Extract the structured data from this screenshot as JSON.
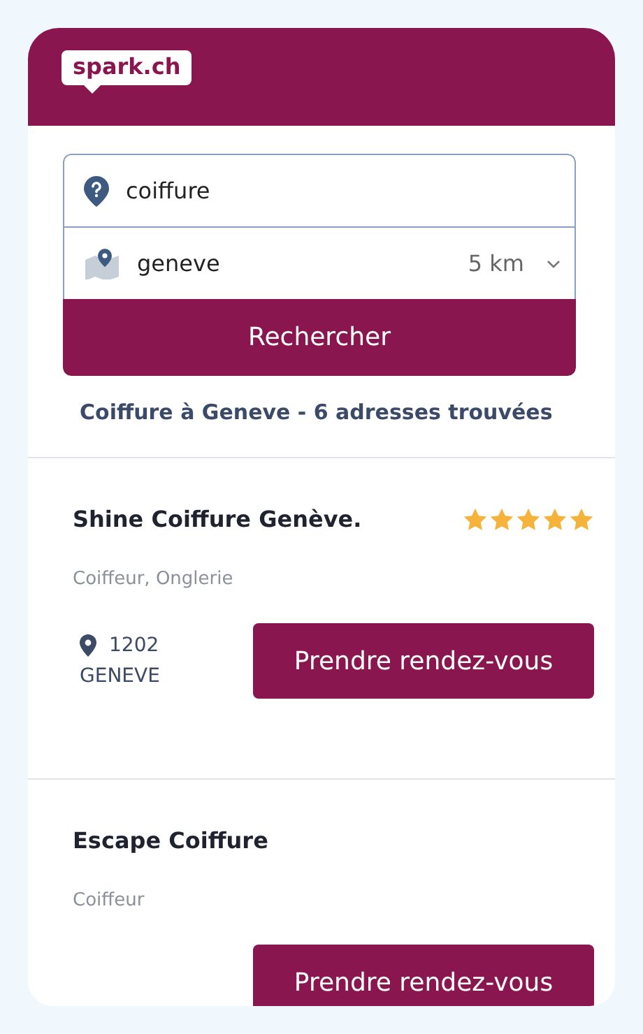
{
  "header": {
    "logo": "spark.ch"
  },
  "search": {
    "query": "coiffure",
    "location": "geneve",
    "radius": "5 km",
    "button": "Rechercher"
  },
  "results_title": "Coiffure à Geneve - 6 adresses trouvées",
  "results": [
    {
      "name": "Shine Coiffure Genève.",
      "stars": 5,
      "categories": "Coiffeur, Onglerie",
      "postcode": "1202",
      "city": "GENEVE",
      "button": "Prendre rendez-vous"
    },
    {
      "name": "Escape Coiffure",
      "categories": "Coiffeur",
      "button": "Prendre rendez-vous"
    }
  ]
}
